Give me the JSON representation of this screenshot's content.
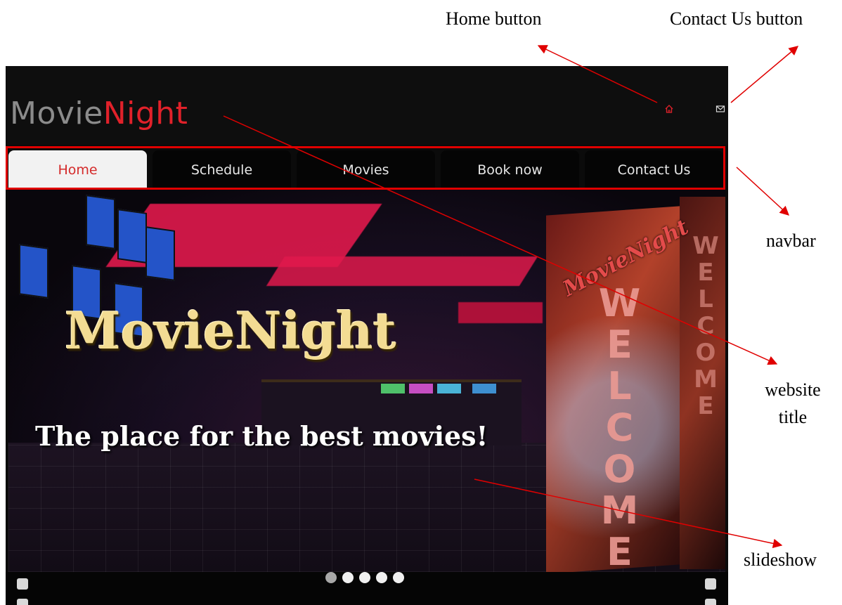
{
  "annotations": {
    "home_button": "Home button",
    "contact_button": "Contact Us button",
    "navbar": "navbar",
    "website_title": "website title",
    "slideshow": "slideshow"
  },
  "site": {
    "title_part1": "Movie",
    "title_part2": "Night",
    "header_icons": [
      "home-icon",
      "mail-icon"
    ],
    "brand_colors": {
      "accent": "#e1212a",
      "title_gray": "#8b8b8b",
      "annotation_red": "#e00000"
    }
  },
  "navbar": {
    "tabs": [
      {
        "label": "Home",
        "active": true
      },
      {
        "label": "Schedule",
        "active": false
      },
      {
        "label": "Movies",
        "active": false
      },
      {
        "label": "Book now",
        "active": false
      },
      {
        "label": "Contact Us",
        "active": false
      }
    ]
  },
  "slideshow": {
    "title": "MovieNight",
    "subtitle": "The place for the best movies!",
    "pillar_brand": "MovieNight",
    "pillar_text": "WELCOME",
    "pillar2_text": "WELCOME",
    "dots_count": 5,
    "active_dot": 1
  }
}
